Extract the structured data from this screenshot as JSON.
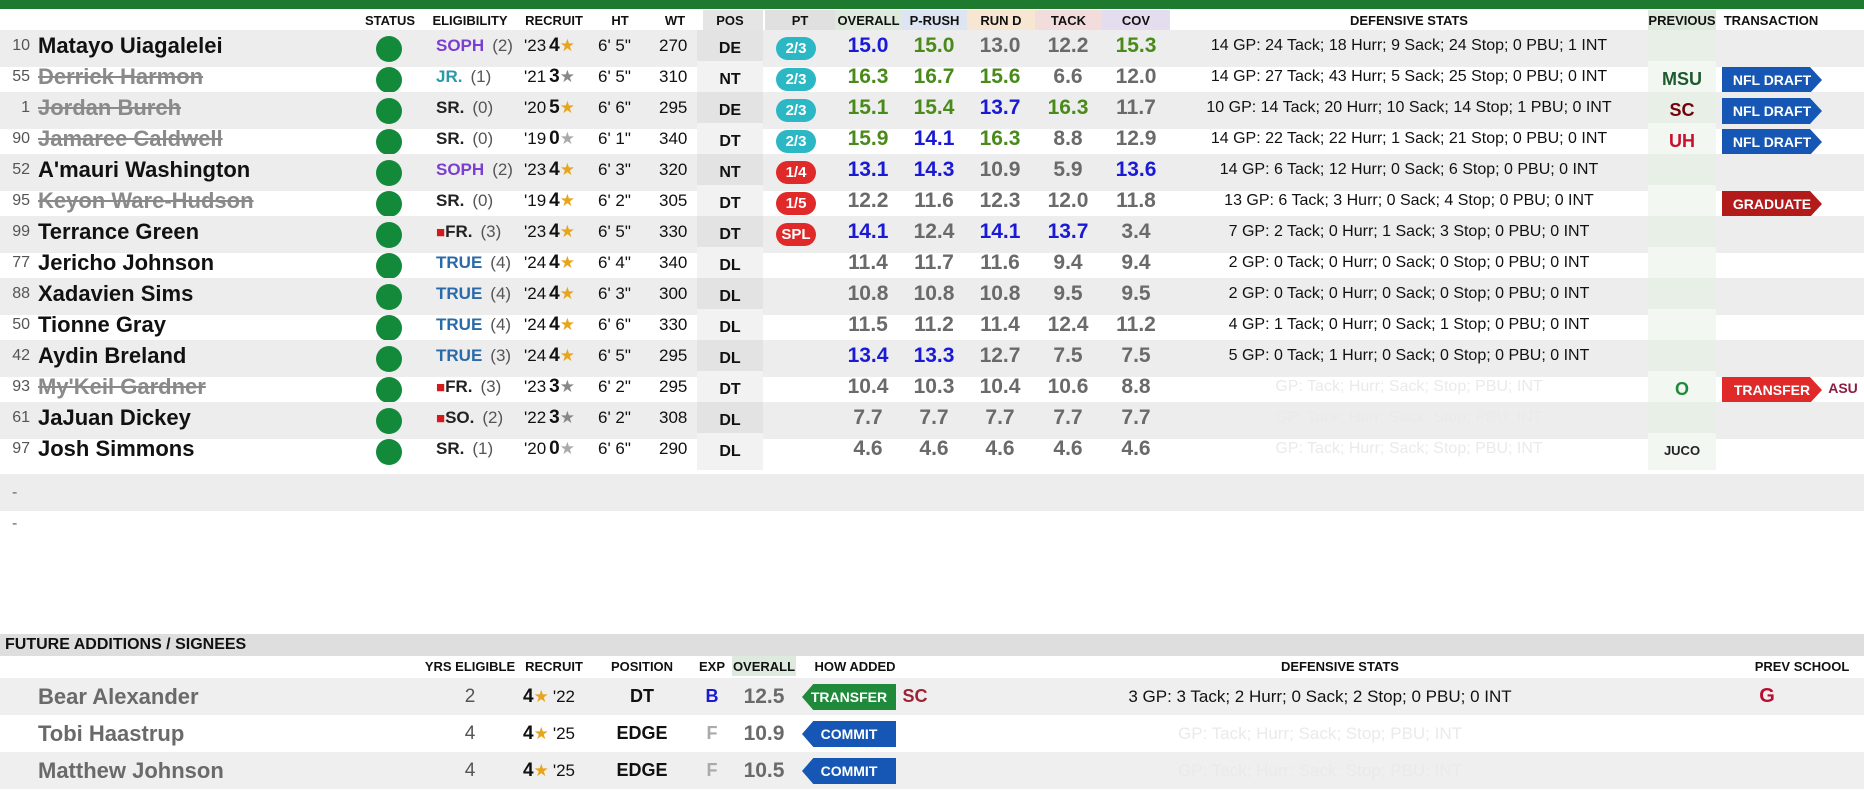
{
  "headers": {
    "status": "STATUS",
    "eligibility": "ELIGIBILITY",
    "recruit": "RECRUIT",
    "ht": "HT",
    "wt": "WT",
    "pos": "POS",
    "pt": "PT",
    "overall": "OVERALL",
    "prush": "P-RUSH",
    "rund": "RUN D",
    "tack": "TACK",
    "cov": "COV",
    "defensive_stats": "DEFENSIVE STATS",
    "previous": "PREVIOUS",
    "transaction": "TRANSACTION"
  },
  "colors": {
    "green": "#128a3a",
    "blue_score": "#1a1ad6",
    "green_score": "#4a8a1a",
    "gray_score": "#6a6a6a"
  },
  "players": [
    {
      "num": "10",
      "name": "Matayo Uiagalelei",
      "strike": false,
      "elig": "SOPH",
      "elig_color": "#7a3fd0",
      "yrs": "(2)",
      "yr": "'23",
      "stars": "4",
      "star_color": "#e8a51b",
      "ht": "6' 5\"",
      "wt": "270",
      "pos": "DE",
      "pt": "2/3",
      "pt_color": "#2bb7c4",
      "overall": "15.0",
      "ov_c": "#1a1ad6",
      "prush": "15.0",
      "pr_c": "#4a8a1a",
      "rund": "13.0",
      "rd_c": "#6a6a6a",
      "tack": "12.2",
      "tk_c": "#6a6a6a",
      "cov": "15.3",
      "cv_c": "#4a8a1a",
      "stats": "14 GP: 24 Tack; 18 Hurr; 9 Sack; 24 Stop; 0 PBU; 1 INT",
      "prev": "",
      "trans": ""
    },
    {
      "num": "55",
      "name": "Derrick Harmon",
      "strike": true,
      "elig": "JR.",
      "elig_color": "#2a9aa8",
      "yrs": "(1)",
      "yr": "'21",
      "stars": "3",
      "star_color": "#888",
      "ht": "6' 5\"",
      "wt": "310",
      "pos": "NT",
      "pt": "2/3",
      "pt_color": "#2bb7c4",
      "overall": "16.3",
      "ov_c": "#4a8a1a",
      "prush": "16.7",
      "pr_c": "#4a8a1a",
      "rund": "15.6",
      "rd_c": "#4a8a1a",
      "tack": "6.6",
      "tk_c": "#6a6a6a",
      "cov": "12.0",
      "cv_c": "#6a6a6a",
      "stats": "14 GP: 27 Tack; 43 Hurr; 5 Sack; 25 Stop; 0 PBU; 0 INT",
      "prev": "MSU",
      "trans": "NFL DRAFT"
    },
    {
      "num": "1",
      "name": "Jordan Burch",
      "strike": true,
      "elig": "SR.",
      "elig_color": "#222",
      "yrs": "(0)",
      "yr": "'20",
      "stars": "5",
      "star_color": "#e8a51b",
      "ht": "6' 6\"",
      "wt": "295",
      "pos": "DE",
      "pt": "2/3",
      "pt_color": "#2bb7c4",
      "overall": "15.1",
      "ov_c": "#4a8a1a",
      "prush": "15.4",
      "pr_c": "#4a8a1a",
      "rund": "13.7",
      "rd_c": "#1a1ad6",
      "tack": "16.3",
      "tk_c": "#4a8a1a",
      "cov": "11.7",
      "cv_c": "#6a6a6a",
      "stats": "10 GP: 14 Tack; 20 Hurr; 10 Sack; 14 Stop; 1 PBU; 0 INT",
      "prev": "SC",
      "trans": "NFL DRAFT"
    },
    {
      "num": "90",
      "name": "Jamaree Caldwell",
      "strike": true,
      "elig": "SR.",
      "elig_color": "#222",
      "yrs": "(0)",
      "yr": "'19",
      "stars": "0",
      "star_color": "#aaa",
      "ht": "6' 1\"",
      "wt": "340",
      "pos": "DT",
      "pt": "2/3",
      "pt_color": "#2bb7c4",
      "overall": "15.9",
      "ov_c": "#4a8a1a",
      "prush": "14.1",
      "pr_c": "#1a1ad6",
      "rund": "16.3",
      "rd_c": "#4a8a1a",
      "tack": "8.8",
      "tk_c": "#6a6a6a",
      "cov": "12.9",
      "cv_c": "#6a6a6a",
      "stats": "14 GP: 22 Tack; 22 Hurr; 1 Sack; 21 Stop; 0 PBU; 0 INT",
      "prev": "UH",
      "trans": "NFL DRAFT"
    },
    {
      "num": "52",
      "name": "A'mauri Washington",
      "strike": false,
      "elig": "SOPH",
      "elig_color": "#7a3fd0",
      "yrs": "(2)",
      "yr": "'23",
      "stars": "4",
      "star_color": "#e8a51b",
      "ht": "6' 3\"",
      "wt": "320",
      "pos": "NT",
      "pt": "1/4",
      "pt_color": "#e02a2a",
      "overall": "13.1",
      "ov_c": "#1a1ad6",
      "prush": "14.3",
      "pr_c": "#1a1ad6",
      "rund": "10.9",
      "rd_c": "#6a6a6a",
      "tack": "5.9",
      "tk_c": "#6a6a6a",
      "cov": "13.6",
      "cv_c": "#1a1ad6",
      "stats": "14 GP: 6 Tack; 12 Hurr; 0 Sack; 6 Stop; 0 PBU; 0 INT",
      "prev": "",
      "trans": ""
    },
    {
      "num": "95",
      "name": "Keyon Ware-Hudson",
      "strike": true,
      "elig": "SR.",
      "elig_color": "#222",
      "yrs": "(0)",
      "yr": "'19",
      "stars": "4",
      "star_color": "#e8a51b",
      "ht": "6' 2\"",
      "wt": "305",
      "pos": "DT",
      "pt": "1/5",
      "pt_color": "#e02a2a",
      "overall": "12.2",
      "ov_c": "#6a6a6a",
      "prush": "11.6",
      "pr_c": "#6a6a6a",
      "rund": "12.3",
      "rd_c": "#6a6a6a",
      "tack": "12.0",
      "tk_c": "#6a6a6a",
      "cov": "11.8",
      "cv_c": "#6a6a6a",
      "stats": "13 GP: 6 Tack; 3 Hurr; 0 Sack; 4 Stop; 0 PBU; 0 INT",
      "prev": "",
      "trans": "GRADUATE"
    },
    {
      "num": "99",
      "name": "Terrance Green",
      "strike": false,
      "elig": "FR.",
      "elig_color": "#222",
      "redshirt": true,
      "yrs": "(3)",
      "yr": "'23",
      "stars": "4",
      "star_color": "#e8a51b",
      "ht": "6' 5\"",
      "wt": "330",
      "pos": "DT",
      "pt": "SPL",
      "pt_color": "#e02a2a",
      "overall": "14.1",
      "ov_c": "#1a1ad6",
      "prush": "12.4",
      "pr_c": "#6a6a6a",
      "rund": "14.1",
      "rd_c": "#1a1ad6",
      "tack": "13.7",
      "tk_c": "#1a1ad6",
      "cov": "3.4",
      "cv_c": "#6a6a6a",
      "stats": "7 GP: 2 Tack; 0 Hurr; 1 Sack; 3 Stop; 0 PBU; 0 INT",
      "prev": "",
      "trans": ""
    },
    {
      "num": "77",
      "name": "Jericho Johnson",
      "strike": false,
      "elig": "TRUE",
      "elig_color": "#2a6aa8",
      "yrs": "(4)",
      "yr": "'24",
      "stars": "4",
      "star_color": "#e8a51b",
      "ht": "6' 4\"",
      "wt": "340",
      "pos": "DL",
      "pt": "",
      "pt_color": "",
      "overall": "11.4",
      "ov_c": "#6a6a6a",
      "prush": "11.7",
      "pr_c": "#6a6a6a",
      "rund": "11.6",
      "rd_c": "#6a6a6a",
      "tack": "9.4",
      "tk_c": "#6a6a6a",
      "cov": "9.4",
      "cv_c": "#6a6a6a",
      "stats": "2 GP: 0 Tack; 0 Hurr; 0 Sack; 0 Stop; 0 PBU; 0 INT",
      "prev": "",
      "trans": ""
    },
    {
      "num": "88",
      "name": "Xadavien Sims",
      "strike": false,
      "elig": "TRUE",
      "elig_color": "#2a6aa8",
      "yrs": "(4)",
      "yr": "'24",
      "stars": "4",
      "star_color": "#e8a51b",
      "ht": "6' 3\"",
      "wt": "300",
      "pos": "DL",
      "pt": "",
      "pt_color": "",
      "overall": "10.8",
      "ov_c": "#6a6a6a",
      "prush": "10.8",
      "pr_c": "#6a6a6a",
      "rund": "10.8",
      "rd_c": "#6a6a6a",
      "tack": "9.5",
      "tk_c": "#6a6a6a",
      "cov": "9.5",
      "cv_c": "#6a6a6a",
      "stats": "2 GP: 0 Tack; 0 Hurr; 0 Sack; 0 Stop; 0 PBU; 0 INT",
      "prev": "",
      "trans": ""
    },
    {
      "num": "50",
      "name": "Tionne Gray",
      "strike": false,
      "elig": "TRUE",
      "elig_color": "#2a6aa8",
      "yrs": "(4)",
      "yr": "'24",
      "stars": "4",
      "star_color": "#e8a51b",
      "ht": "6' 6\"",
      "wt": "330",
      "pos": "DL",
      "pt": "",
      "pt_color": "",
      "overall": "11.5",
      "ov_c": "#6a6a6a",
      "prush": "11.2",
      "pr_c": "#6a6a6a",
      "rund": "11.4",
      "rd_c": "#6a6a6a",
      "tack": "12.4",
      "tk_c": "#6a6a6a",
      "cov": "11.2",
      "cv_c": "#6a6a6a",
      "stats": "4 GP: 1 Tack; 0 Hurr; 0 Sack; 1 Stop; 0 PBU; 0 INT",
      "prev": "",
      "trans": ""
    },
    {
      "num": "42",
      "name": "Aydin Breland",
      "strike": false,
      "elig": "TRUE",
      "elig_color": "#2a6aa8",
      "yrs": "(3)",
      "yr": "'24",
      "stars": "4",
      "star_color": "#e8a51b",
      "ht": "6' 5\"",
      "wt": "295",
      "pos": "DL",
      "pt": "",
      "pt_color": "",
      "overall": "13.4",
      "ov_c": "#1a1ad6",
      "prush": "13.3",
      "pr_c": "#1a1ad6",
      "rund": "12.7",
      "rd_c": "#6a6a6a",
      "tack": "7.5",
      "tk_c": "#6a6a6a",
      "cov": "7.5",
      "cv_c": "#6a6a6a",
      "stats": "5 GP: 0 Tack; 1 Hurr; 0 Sack; 0 Stop; 0 PBU; 0 INT",
      "prev": "",
      "trans": ""
    },
    {
      "num": "93",
      "name": "My'Keil Gardner",
      "strike": true,
      "elig": "FR.",
      "elig_color": "#222",
      "redshirt": true,
      "yrs": "(3)",
      "yr": "'23",
      "stars": "3",
      "star_color": "#888",
      "ht": "6' 2\"",
      "wt": "295",
      "pos": "DT",
      "pt": "",
      "pt_color": "",
      "overall": "10.4",
      "ov_c": "#6a6a6a",
      "prush": "10.3",
      "pr_c": "#6a6a6a",
      "rund": "10.4",
      "rd_c": "#6a6a6a",
      "tack": "10.6",
      "tk_c": "#6a6a6a",
      "cov": "8.8",
      "cv_c": "#6a6a6a",
      "stats": "GP:  Tack;  Hurr;  Sack;  Stop;  PBU;  INT",
      "faint": true,
      "prev": "O",
      "trans": "TRANSFER",
      "dest": "ASU"
    },
    {
      "num": "61",
      "name": "JaJuan Dickey",
      "strike": false,
      "elig": "SO.",
      "elig_color": "#222",
      "redshirt": true,
      "yrs": "(2)",
      "yr": "'22",
      "stars": "3",
      "star_color": "#888",
      "ht": "6' 2\"",
      "wt": "308",
      "pos": "DL",
      "pt": "",
      "pt_color": "",
      "overall": "7.7",
      "ov_c": "#6a6a6a",
      "prush": "7.7",
      "pr_c": "#6a6a6a",
      "rund": "7.7",
      "rd_c": "#6a6a6a",
      "tack": "7.7",
      "tk_c": "#6a6a6a",
      "cov": "7.7",
      "cv_c": "#6a6a6a",
      "stats": "GP:  Tack;  Hurr;  Sack;  Stop;  PBU;  INT",
      "faint": true,
      "prev": "",
      "trans": ""
    },
    {
      "num": "97",
      "name": "Josh Simmons",
      "strike": false,
      "elig": "SR.",
      "elig_color": "#222",
      "yrs": "(1)",
      "yr": "'20",
      "stars": "0",
      "star_color": "#aaa",
      "ht": "6' 6\"",
      "wt": "290",
      "pos": "DL",
      "pt": "",
      "pt_color": "",
      "overall": "4.6",
      "ov_c": "#6a6a6a",
      "prush": "4.6",
      "pr_c": "#6a6a6a",
      "rund": "4.6",
      "rd_c": "#6a6a6a",
      "tack": "4.6",
      "tk_c": "#6a6a6a",
      "cov": "4.6",
      "cv_c": "#6a6a6a",
      "stats": "GP:  Tack;  Hurr;  Sack;  Stop;  PBU;  INT",
      "faint": true,
      "prev": "JUCO",
      "trans": ""
    }
  ],
  "empty_rows": [
    "-",
    "-"
  ],
  "future": {
    "title": "FUTURE ADDITIONS / SIGNEES",
    "headers": {
      "yrs": "YRS ELIGIBLE",
      "recruit": "RECRUIT",
      "position": "POSITION",
      "exp": "EXP",
      "overall": "OVERALL",
      "how": "HOW ADDED",
      "stats": "DEFENSIVE STATS",
      "prev": "PREV SCHOOL"
    },
    "players": [
      {
        "name": "Bear Alexander",
        "yrs": "2",
        "stars": "4",
        "yr": "'22",
        "pos": "DT",
        "exp": "B",
        "exp_color": "#1a1ad6",
        "overall": "12.5",
        "how": "TRANSFER",
        "how_color": "#1e8a3a",
        "stats": "3 GP: 3 Tack; 2 Hurr; 0 Sack; 2 Stop; 0 PBU; 0 INT",
        "faint": false,
        "prev": "G",
        "from_logo": "SC"
      },
      {
        "name": "Tobi Haastrup",
        "yrs": "4",
        "stars": "4",
        "yr": "'25",
        "pos": "EDGE",
        "exp": "F",
        "exp_color": "#aaa",
        "overall": "10.9",
        "how": "COMMIT",
        "how_color": "#1657b5",
        "stats": "GP:  Tack;  Hurr;  Sack;  Stop;  PBU;  INT",
        "faint": true,
        "prev": ""
      },
      {
        "name": "Matthew Johnson",
        "yrs": "4",
        "stars": "4",
        "yr": "'25",
        "pos": "EDGE",
        "exp": "F",
        "exp_color": "#aaa",
        "overall": "10.5",
        "how": "COMMIT",
        "how_color": "#1657b5",
        "stats": "GP:  Tack;  Hurr;  Sack;  Stop;  PBU;  INT",
        "faint": true,
        "prev": ""
      }
    ]
  }
}
